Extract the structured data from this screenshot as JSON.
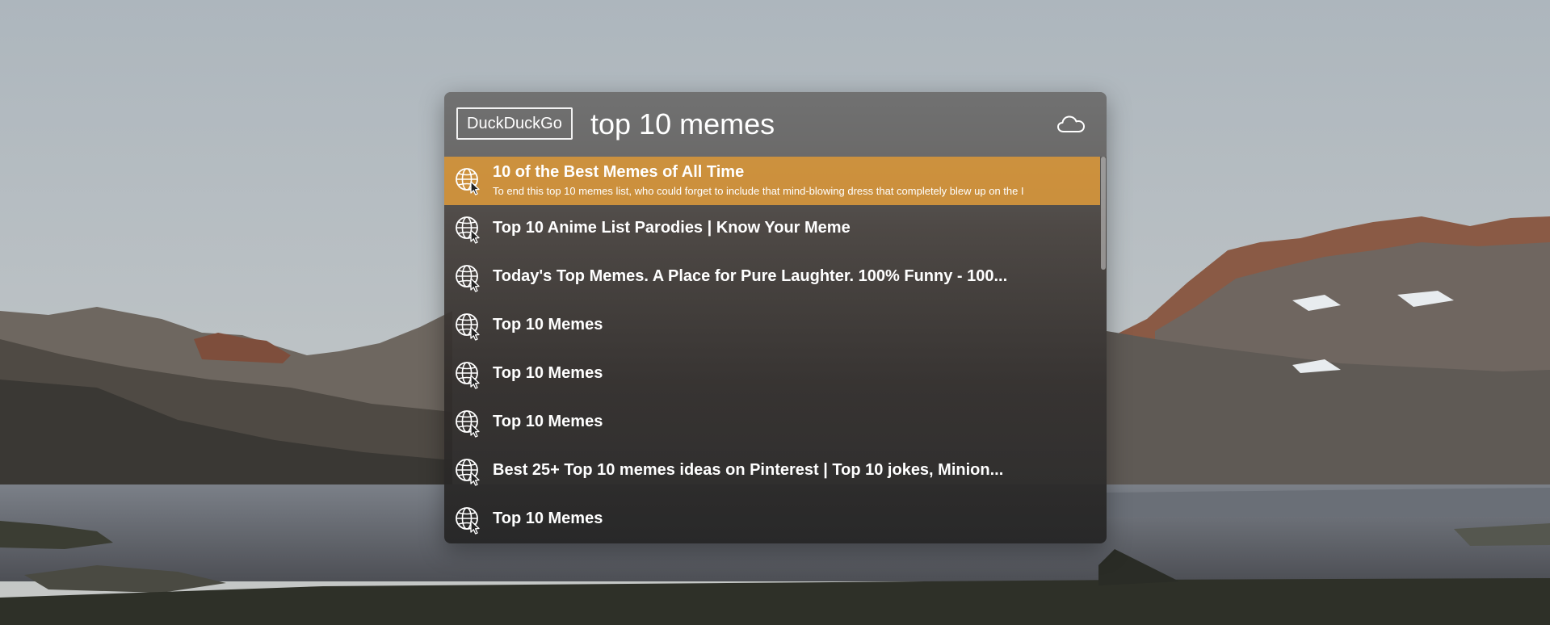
{
  "launcher": {
    "provider_label": "DuckDuckGo",
    "query": "top 10 memes",
    "cloud_icon": "cloud-icon",
    "result_icon": "globe-cursor-icon",
    "accent_color": "#d6963c"
  },
  "results": [
    {
      "title": "10 of the Best Memes of All Time",
      "subtitle": "To end this top 10 memes list, who could forget to include that mind-blowing dress that completely blew up on the I",
      "selected": true
    },
    {
      "title": "Top 10 Anime List Parodies | Know Your Meme"
    },
    {
      "title": "Today's Top Memes. A Place for Pure Laughter. 100% Funny - 100..."
    },
    {
      "title": "Top 10 Memes"
    },
    {
      "title": "Top 10 Memes"
    },
    {
      "title": "Top 10 Memes"
    },
    {
      "title": "Best 25+ Top 10 memes ideas on Pinterest | Top 10 jokes, Minion..."
    },
    {
      "title": "Top 10 Memes"
    }
  ]
}
